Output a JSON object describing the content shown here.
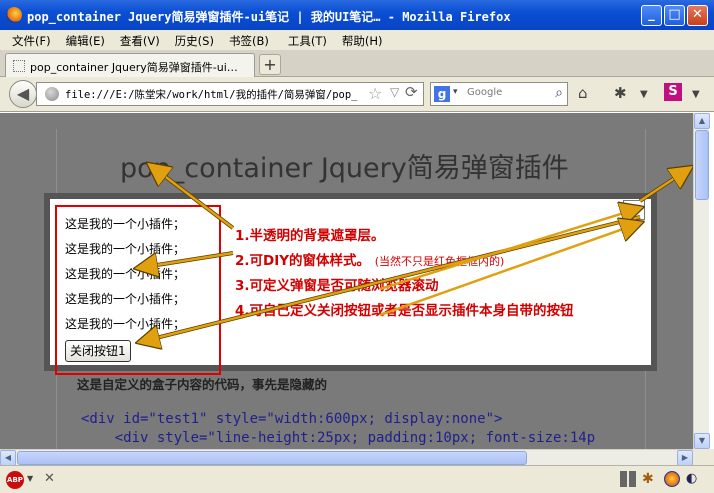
{
  "window": {
    "title": "pop_container Jquery简易弹窗插件-ui笔记 | 我的UI笔记… - Mozilla Firefox",
    "minimize": "_",
    "maximize": "□",
    "close": "✕"
  },
  "menu": [
    "文件(F)",
    "编辑(E)",
    "查看(V)",
    "历史(S)",
    "书签(B)",
    "工具(T)",
    "帮助(H)"
  ],
  "tab": {
    "label": "pop_container Jquery简易弹窗插件-ui…",
    "new_tab": "+"
  },
  "nav": {
    "url": "file:///E:/陈堂宋/work/html/我的插件/简易弹窗/pop_",
    "search_placeholder": "Google",
    "search_engine": "g"
  },
  "page": {
    "title": "pop_container Jquery简易弹窗插件",
    "caption": "这是自定义的盒子内容的代码，事先是隐藏的",
    "code": [
      "<div id=\"test1\" style=\"width:600px; display:none\">",
      "    <div style=\"line-height:25px; padding:10px; font-size:14p"
    ]
  },
  "popup": {
    "rows": [
      "这是我的一个小插件；",
      "这是我的一个小插件；",
      "这是我的一个小插件；",
      "这是我的一个小插件；",
      "这是我的一个小插件；"
    ],
    "close_button": "关闭按钮1",
    "close_x": "✕",
    "notes": [
      "1.半透明的背景遮罩层。",
      "2.可DIY的窗体样式。",
      "3.可定义弹窗是否可随浏览器滚动",
      "4.可自己定义关闭按钮或者是否显示插件本身自带的按钮"
    ],
    "note2_sub": "(当然不只是红色框框内的)"
  },
  "status": {
    "abp": "ABP",
    "close": "✕"
  },
  "colors": {
    "annotation": "#d20000",
    "arrow": "#e0a010",
    "titlebar": "#0a4fd4"
  }
}
